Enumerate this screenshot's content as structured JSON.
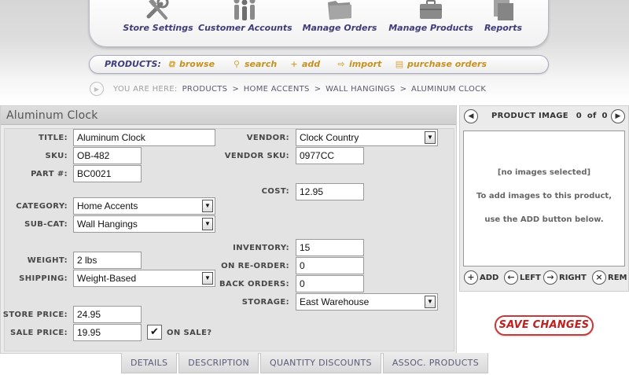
{
  "nav": {
    "items": [
      {
        "label": "Store Settings",
        "icon": "tools-icon"
      },
      {
        "label": "Customer Accounts",
        "icon": "people-icon"
      },
      {
        "label": "Manage Orders",
        "icon": "folder-icon"
      },
      {
        "label": "Manage Products",
        "icon": "briefcase-icon"
      },
      {
        "label": "Reports",
        "icon": "pages-icon"
      }
    ]
  },
  "subnav": {
    "label": "PRODUCTS:",
    "items": [
      {
        "label": "browse"
      },
      {
        "label": "search"
      },
      {
        "label": "add"
      },
      {
        "label": "import"
      },
      {
        "label": "purchase orders"
      }
    ]
  },
  "breadcrumb": {
    "prefix": "YOU ARE HERE:",
    "items": [
      "PRODUCTS",
      "HOME ACCENTS",
      "WALL HANGINGS",
      "ALUMINUM CLOCK"
    ],
    "separator": ">"
  },
  "product": {
    "title": "Aluminum Clock",
    "labels": {
      "title": "TITLE:",
      "sku": "SKU:",
      "part": "PART #:",
      "category": "CATEGORY:",
      "subcat": "SUB-CAT:",
      "weight": "WEIGHT:",
      "shipping": "SHIPPING:",
      "store_price": "STORE PRICE:",
      "sale_price": "SALE PRICE:",
      "on_sale": "ON SALE?",
      "vendor": "VENDOR:",
      "vendor_sku": "VENDOR SKU:",
      "cost": "COST:",
      "inventory": "INVENTORY:",
      "on_reorder": "ON RE-ORDER:",
      "back_orders": "BACK ORDERS:",
      "storage": "STORAGE:"
    },
    "values": {
      "title": "Aluminum Clock",
      "sku": "OB-482",
      "part": "BC0021",
      "category": "Home Accents",
      "subcat": "Wall Hangings",
      "weight": "2 lbs",
      "shipping": "Weight-Based",
      "store_price": "24.95",
      "sale_price": "19.95",
      "on_sale_mark": "✔",
      "vendor": "Clock Country",
      "vendor_sku": "0977CC",
      "cost": "12.95",
      "inventory": "15",
      "on_reorder": "0",
      "back_orders": "0",
      "storage": "East Warehouse"
    }
  },
  "tabs": [
    "DETAILS",
    "DESCRIPTION",
    "QUANTITY DISCOUNTS",
    "ASSOC. PRODUCTS"
  ],
  "image_panel": {
    "title": "PRODUCT IMAGE",
    "index": "0",
    "of": "of",
    "total": "0",
    "empty_line1": "[no images selected]",
    "empty_line2": "To add images to this product,",
    "empty_line3": "use the ADD button below.",
    "tools": [
      "ADD",
      "LEFT",
      "RIGHT",
      "REM"
    ]
  },
  "save_label": "SAVE CHANGES",
  "colors": {
    "accent": "#3d3d7a",
    "subnav": "#c8901d",
    "save": "#c0201f"
  }
}
